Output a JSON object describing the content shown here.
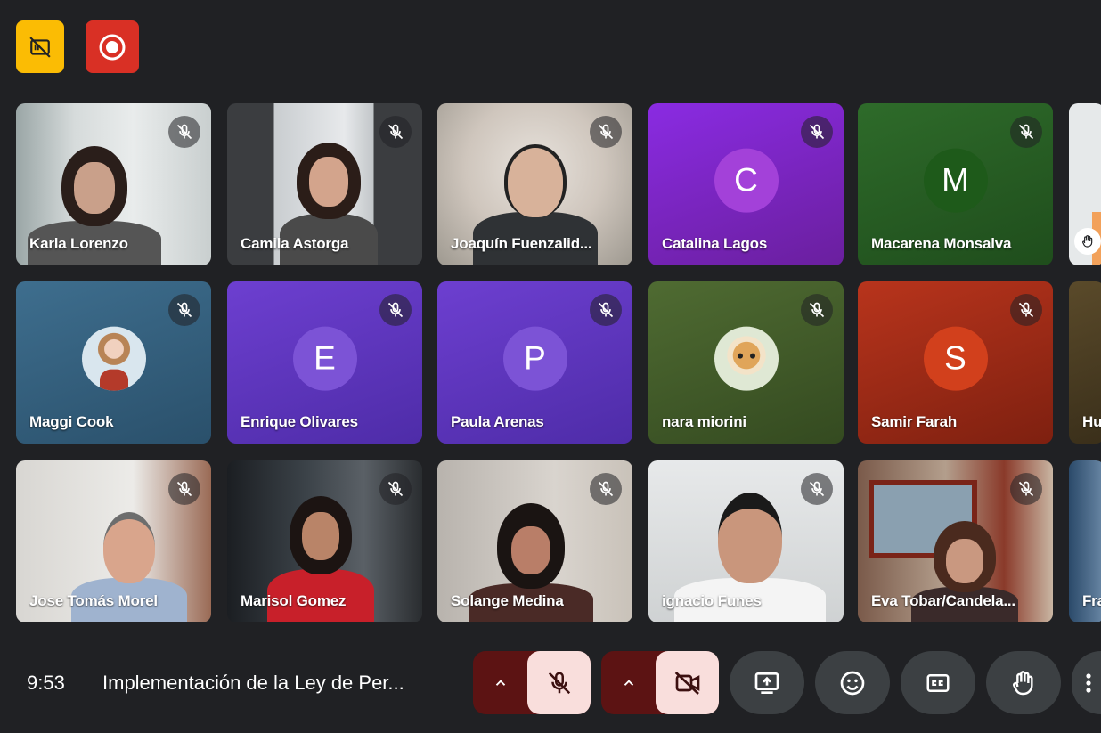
{
  "top_controls": [
    {
      "icon": "no-video-hd-icon",
      "color": "#fbbc04"
    },
    {
      "icon": "record-icon",
      "color": "#d93025"
    }
  ],
  "participants": [
    {
      "name": "Karla Lorenzo",
      "type": "video",
      "muted": true
    },
    {
      "name": "Camila Astorga",
      "type": "video",
      "muted": true
    },
    {
      "name": "Joaquín Fuenzalid...",
      "type": "video",
      "muted": true
    },
    {
      "name": "Catalina Lagos",
      "type": "initial",
      "initial": "C",
      "muted": true
    },
    {
      "name": "Macarena Monsalva",
      "type": "initial",
      "initial": "M",
      "muted": true
    },
    {
      "name": "",
      "type": "video",
      "partial": true,
      "hand_raised": true
    },
    {
      "name": "Maggi Cook",
      "type": "photo-avatar",
      "muted": true
    },
    {
      "name": "Enrique Olivares",
      "type": "initial",
      "initial": "E",
      "muted": true
    },
    {
      "name": "Paula Arenas",
      "type": "initial",
      "initial": "P",
      "muted": true
    },
    {
      "name": "nara miorini",
      "type": "photo-avatar",
      "muted": true
    },
    {
      "name": "Samir Farah",
      "type": "initial",
      "initial": "S",
      "muted": true
    },
    {
      "name": "Hu",
      "type": "initial",
      "partial": true
    },
    {
      "name": "Jose Tomás Morel",
      "type": "video",
      "muted": true
    },
    {
      "name": "Marisol Gomez",
      "type": "video",
      "muted": true
    },
    {
      "name": "Solange Medina",
      "type": "video",
      "muted": true
    },
    {
      "name": "ignacio Funes",
      "type": "video",
      "muted": true
    },
    {
      "name": "Eva Tobar/Candela...",
      "type": "video",
      "muted": true
    },
    {
      "name": "Fra",
      "type": "video",
      "partial": true
    }
  ],
  "bottom_bar": {
    "time": "9:53",
    "meeting_title": "Implementación de la Ley de Per...",
    "mic": {
      "state": "off",
      "icon": "mic-off-icon"
    },
    "camera": {
      "state": "off",
      "icon": "videocam-off-icon"
    },
    "buttons": [
      {
        "icon": "present-screen-icon"
      },
      {
        "icon": "emoji-icon"
      },
      {
        "icon": "captions-icon"
      },
      {
        "icon": "raise-hand-icon"
      },
      {
        "icon": "more-options-icon"
      }
    ]
  },
  "colors": {
    "background": "#202124",
    "mic_cam_off_bg": "#5c1313",
    "mic_cam_off_icon_bg": "#f9dedc",
    "control_bg": "#3c4043"
  }
}
